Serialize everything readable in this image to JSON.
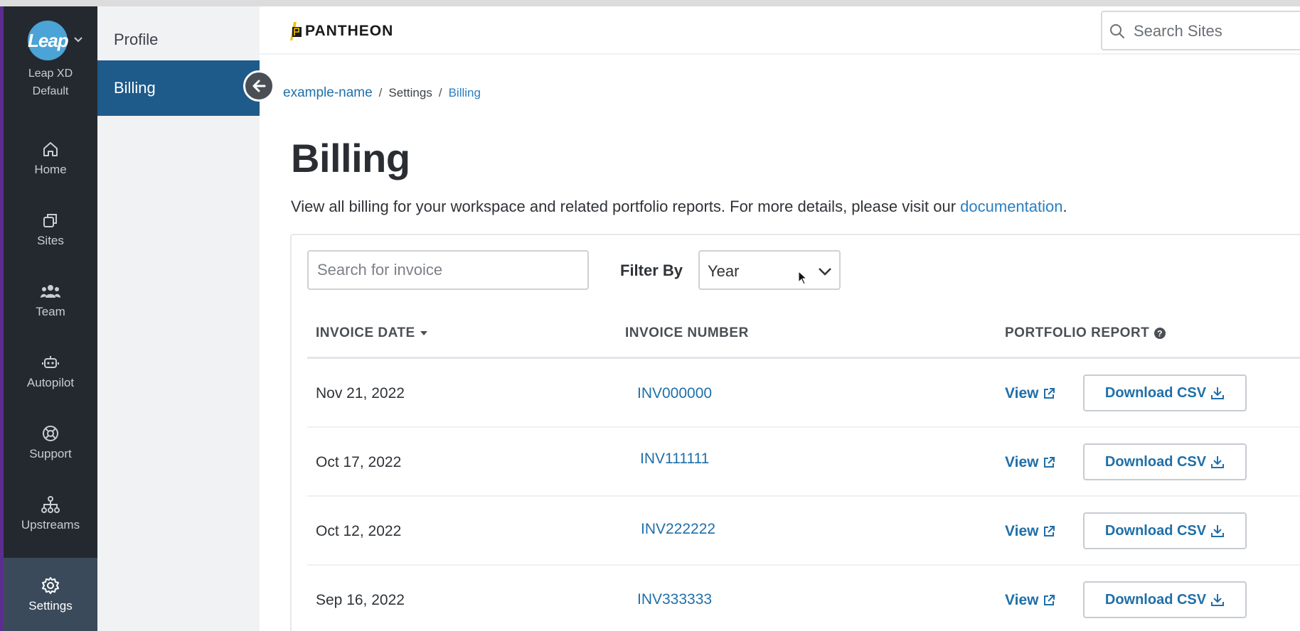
{
  "workspace": {
    "logo_text": "Leap",
    "name_line1": "Leap XD",
    "name_line2": "Default"
  },
  "rail": [
    {
      "icon": "home-icon",
      "label": "Home"
    },
    {
      "icon": "sites-icon",
      "label": "Sites"
    },
    {
      "icon": "team-icon",
      "label": "Team"
    },
    {
      "icon": "autopilot-icon",
      "label": "Autopilot"
    },
    {
      "icon": "support-icon",
      "label": "Support"
    },
    {
      "icon": "upstreams-icon",
      "label": "Upstreams"
    },
    {
      "icon": "gear-icon",
      "label": "Settings",
      "active": true
    }
  ],
  "subnav": [
    {
      "label": "Profile"
    },
    {
      "label": "Billing",
      "active": true
    }
  ],
  "header": {
    "logo_text": "PANTHEON",
    "search_placeholder": "Search Sites"
  },
  "breadcrumb": {
    "site": "example-name",
    "settings": "Settings",
    "current": "Billing",
    "separator": "/"
  },
  "page": {
    "title": "Billing",
    "description": "View all billing for your workspace and related portfolio reports. For more details, please visit our ",
    "doc_link": "documentation",
    "description_end": "."
  },
  "filters": {
    "search_placeholder": "Search for invoice",
    "filter_label": "Filter By",
    "filter_value": "Year"
  },
  "table": {
    "headers": {
      "date": "INVOICE DATE",
      "number": "INVOICE NUMBER",
      "report": "PORTFOLIO REPORT"
    },
    "view_label": "View",
    "download_label": "Download CSV",
    "rows": [
      {
        "date": "Nov 21, 2022",
        "number": "INV000000"
      },
      {
        "date": "Oct 17, 2022",
        "number": "INV111111"
      },
      {
        "date": "Oct 12, 2022",
        "number": "INV222222"
      },
      {
        "date": "Sep 16, 2022",
        "number": "INV333333"
      }
    ]
  },
  "colors": {
    "rail_bg": "#24292f",
    "active_nav": "#1e5a8a",
    "link": "#1f6fa8",
    "accent_purple": "#5b2d8e"
  }
}
